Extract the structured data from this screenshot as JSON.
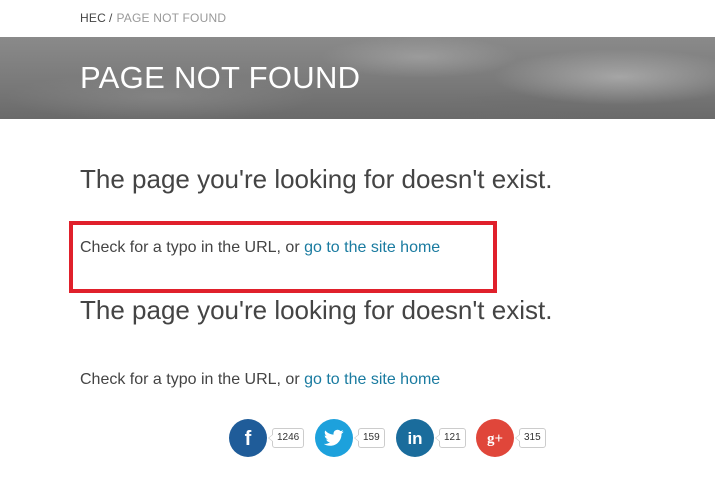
{
  "breadcrumb": {
    "home": "HEC",
    "separator": "/",
    "current": "PAGE NOT FOUND"
  },
  "hero": {
    "title": "PAGE NOT FOUND"
  },
  "content": {
    "heading_1": "The page you're looking for doesn't exist.",
    "message_1_prefix": "Check for a typo in the URL, or ",
    "message_1_link": "go to the site home",
    "heading_2": "The page you're looking for doesn't exist.",
    "message_2_prefix": "Check for a typo in the URL, or ",
    "message_2_link": "go to the site home"
  },
  "share": {
    "items": [
      {
        "network": "facebook",
        "icon": "facebook-icon",
        "count": "1246",
        "color": "#1f5c99"
      },
      {
        "network": "twitter",
        "icon": "twitter-icon",
        "count": "159",
        "color": "#1da1dc"
      },
      {
        "network": "linkedin",
        "icon": "linkedin-icon",
        "count": "121",
        "color": "#1a6c9c"
      },
      {
        "network": "googleplus",
        "icon": "google-plus-icon",
        "count": "315",
        "color": "#e0463a"
      }
    ]
  },
  "colors": {
    "link": "#1a7ba0",
    "text": "#444444",
    "highlight": "#e0202b"
  }
}
